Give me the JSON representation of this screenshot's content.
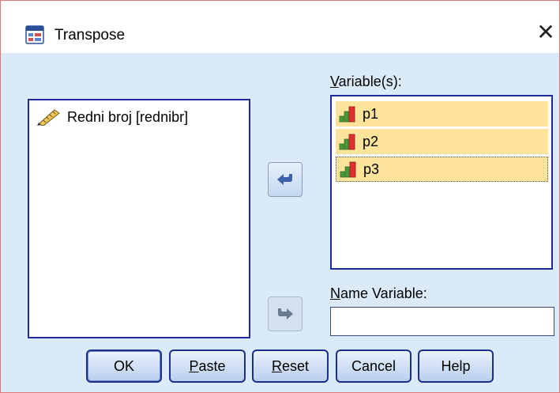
{
  "window": {
    "title": "Transpose",
    "close_glyph": "✕",
    "app_icon": "spss-transpose-icon"
  },
  "source": {
    "items": [
      {
        "label": "Redni broj [rednibr]",
        "icon": "ruler-pencil-scale-icon"
      }
    ]
  },
  "variables": {
    "label_prefix": "V",
    "label_rest": "ariable(s):",
    "items": [
      {
        "label": "p1",
        "icon": "ordinal-bar-icon",
        "selected": true
      },
      {
        "label": "p2",
        "icon": "ordinal-bar-icon",
        "selected": true
      },
      {
        "label": "p3",
        "icon": "ordinal-bar-icon",
        "selected": true,
        "focused": true
      }
    ]
  },
  "name_variable": {
    "label_prefix": "N",
    "label_rest": "ame Variable:",
    "value": ""
  },
  "buttons": {
    "ok": "OK",
    "paste_prefix": "P",
    "paste_rest": "aste",
    "reset_prefix": "R",
    "reset_rest": "eset",
    "cancel": "Cancel",
    "help": "Help"
  },
  "colors": {
    "dialog_bg": "#dbeaf8",
    "list_border": "#1f2a9a",
    "selection": "#fde49a",
    "window_border": "#e07878"
  }
}
